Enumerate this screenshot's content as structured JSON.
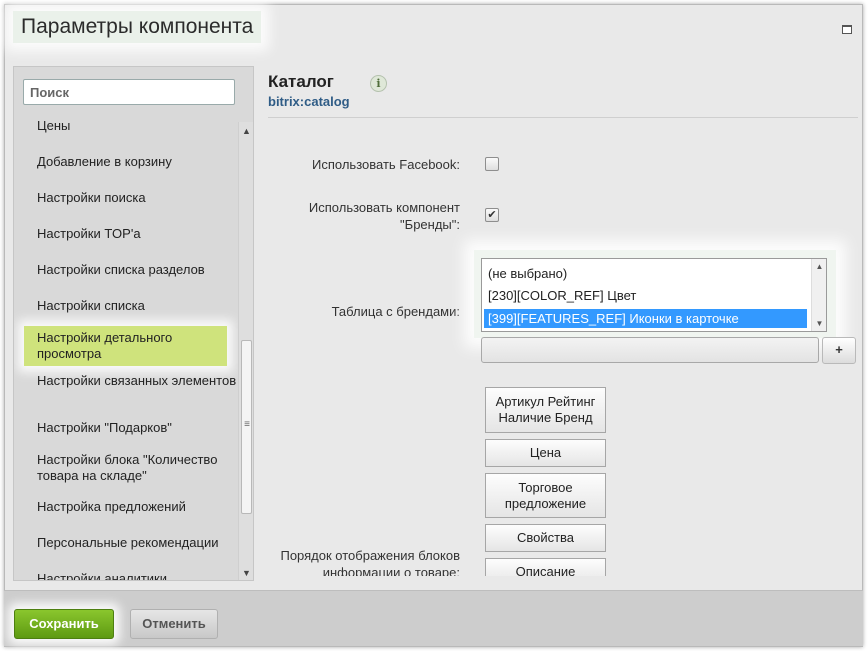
{
  "dialog": {
    "title": "Параметры компонента"
  },
  "sidebar": {
    "search_placeholder": "Поиск",
    "items": [
      {
        "label": "Цены"
      },
      {
        "label": "Добавление в корзину"
      },
      {
        "label": "Настройки поиска"
      },
      {
        "label": "Настройки TOP'а"
      },
      {
        "label": "Настройки списка разделов"
      },
      {
        "label": "Настройки списка"
      },
      {
        "label": "Настройки детального просмотра",
        "active": true
      },
      {
        "label": "Настройки связанных элементов"
      },
      {
        "label": "Настройки \"Подарков\""
      },
      {
        "label": "Настройки блока \"Количество товара на складе\""
      },
      {
        "label": "Настройка предложений"
      },
      {
        "label": "Персональные рекомендации"
      },
      {
        "label": "Настройки аналитики"
      }
    ]
  },
  "content": {
    "title": "Каталог",
    "subtitle": "bitrix:catalog",
    "info_icon": "i",
    "fields": {
      "use_facebook": {
        "label": "Использовать Facebook:",
        "checked": false
      },
      "use_brands": {
        "label": "Использовать компонент \"Бренды\":",
        "checked": true,
        "check_glyph": "✔"
      },
      "brands_table": {
        "label": "Таблица с брендами:",
        "options": [
          {
            "text": "(не выбрано)"
          },
          {
            "text": "[230][COLOR_REF] Цвет"
          },
          {
            "text": "[399][FEATURES_REF] Иконки в карточке",
            "selected": true
          }
        ],
        "input_value": "",
        "add_label": "+"
      },
      "blocks_order": {
        "label": "Порядок отображения блоков информации о товаре:",
        "blocks": [
          "Артикул Рейтинг Наличие Бренд",
          "Цена",
          "Торговое предложение",
          "Свойства",
          "Описание"
        ]
      }
    }
  },
  "footer": {
    "save_label": "Сохранить",
    "cancel_label": "Отменить"
  },
  "colors": {
    "accent_green": "#6aa81a",
    "active_item": "#cfe37c",
    "selection": "#3399ff",
    "link": "#2f5c86"
  }
}
